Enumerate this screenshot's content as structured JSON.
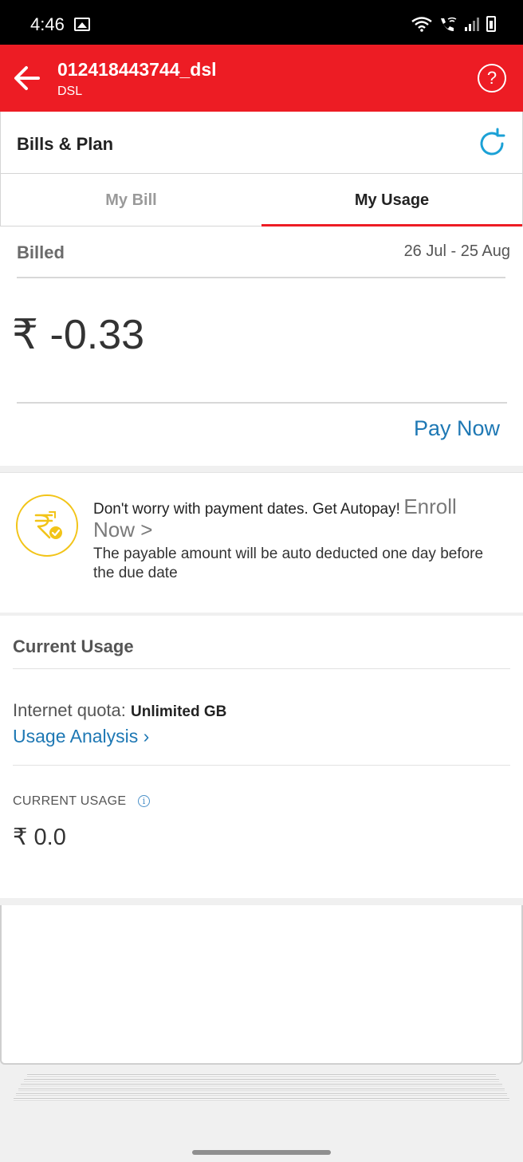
{
  "status_bar": {
    "time": "4:46"
  },
  "app_bar": {
    "title": "012418443744_dsl",
    "subtitle": "DSL",
    "help_glyph": "?"
  },
  "section": {
    "title": "Bills & Plan"
  },
  "tabs": [
    {
      "label": "My Bill",
      "active": false
    },
    {
      "label": "My Usage",
      "active": true
    }
  ],
  "bill": {
    "label": "Billed",
    "range": "26 Jul - 25 Aug",
    "amount": "₹ -0.33",
    "pay_label": "Pay Now"
  },
  "autopay": {
    "message": "Don't worry with payment dates. Get Autopay!",
    "enroll": "Enroll Now >",
    "detail": "The payable amount will be auto deducted one day before the due date"
  },
  "usage": {
    "title": "Current Usage",
    "quota_label": "Internet quota:",
    "quota_value": "Unlimited GB",
    "analysis_link": "Usage Analysis ›",
    "current_label": "CURRENT USAGE",
    "current_value": "₹ 0.0"
  },
  "colors": {
    "brand": "#ed1c24",
    "link": "#1e78b4",
    "autopay_accent": "#f2c418"
  }
}
